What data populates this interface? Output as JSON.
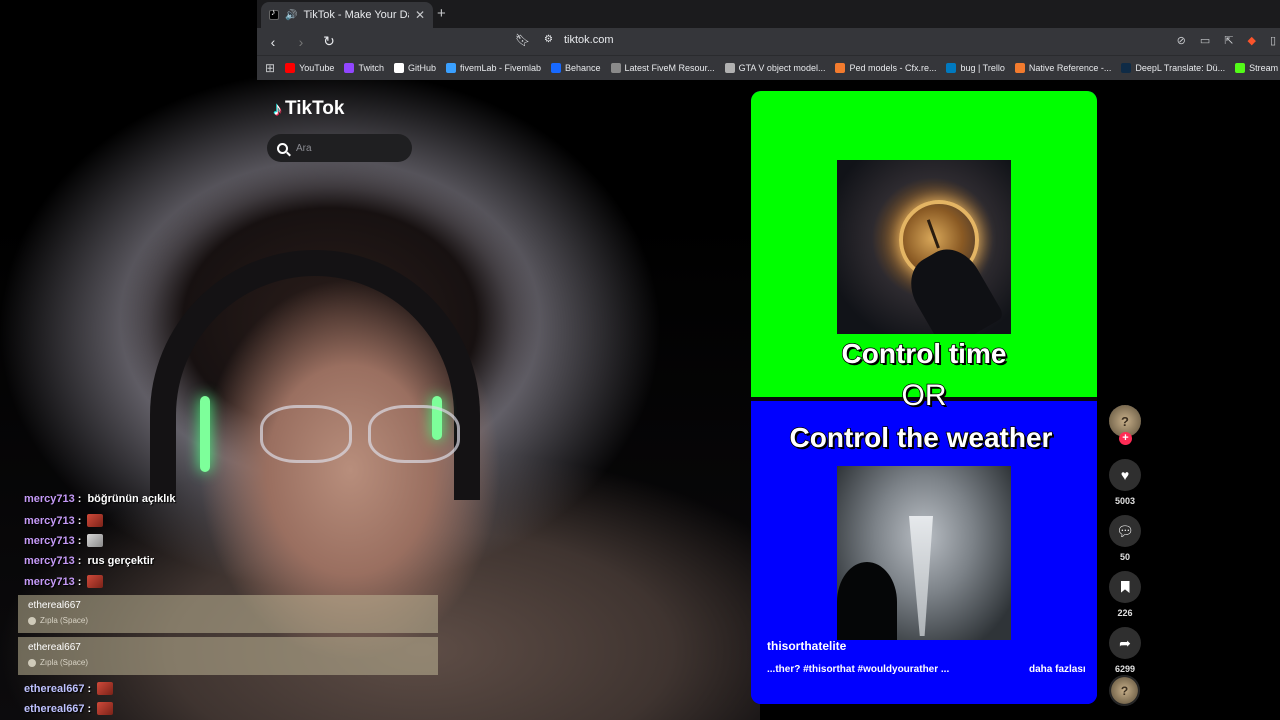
{
  "browser": {
    "tab_title": "TikTok - Make Your Day",
    "new_tab_icon": "plus-icon",
    "url": "tiktok.com",
    "bookmarks": [
      {
        "label": "YouTube",
        "color": "#ff0000"
      },
      {
        "label": "Twitch",
        "color": "#9146ff"
      },
      {
        "label": "GitHub",
        "color": "#ffffff"
      },
      {
        "label": "fivemLab - Fivemlab",
        "color": "#3aa0ff"
      },
      {
        "label": "Behance",
        "color": "#1769ff"
      },
      {
        "label": "Latest FiveM Resour...",
        "color": "#8a8a8a"
      },
      {
        "label": "GTA V object model...",
        "color": "#b0b0b0"
      },
      {
        "label": "Ped models - Cfx.re...",
        "color": "#f37b2e"
      },
      {
        "label": "bug | Trello",
        "color": "#0079bf"
      },
      {
        "label": "Native Reference -...",
        "color": "#f37b2e"
      },
      {
        "label": "DeepL Translate: Dü...",
        "color": "#0f2b46"
      },
      {
        "label": "Stream - Kick",
        "color": "#53fc18"
      }
    ]
  },
  "tiktok": {
    "logo_text": "TikTok",
    "search_placeholder": "Ara",
    "video": {
      "line1": "Control time",
      "line2": "OR",
      "line3": "Control the weather",
      "author": "thisorthatelite",
      "caption": "...ther? #thisorthat #wouldyourather ...",
      "more_label": "daha fazlası",
      "colors": {
        "top": "#00ff00",
        "bottom": "#0000ff"
      }
    },
    "actions": {
      "likes": "5003",
      "comments": "50",
      "saves": "226",
      "shares": "6299"
    }
  },
  "chat": {
    "lines": [
      {
        "user": "mercy713",
        "text": "böğrünün açıklık",
        "emote": false
      },
      {
        "user": "mercy713",
        "text": "",
        "emote": true
      },
      {
        "user": "mercy713",
        "text": "",
        "emote": true
      },
      {
        "user": "mercy713",
        "text": "rus gerçektir",
        "emote": false
      },
      {
        "user": "mercy713",
        "text": "",
        "emote": true
      }
    ],
    "boxes": [
      {
        "user": "ethereal667",
        "sub": "Zıpla (Space)"
      },
      {
        "user": "ethereal667",
        "sub": "Zıpla (Space)"
      }
    ],
    "bottom_lines": [
      {
        "user": "ethereal667",
        "text": ""
      },
      {
        "user": "ethereal667",
        "text": ""
      }
    ]
  }
}
